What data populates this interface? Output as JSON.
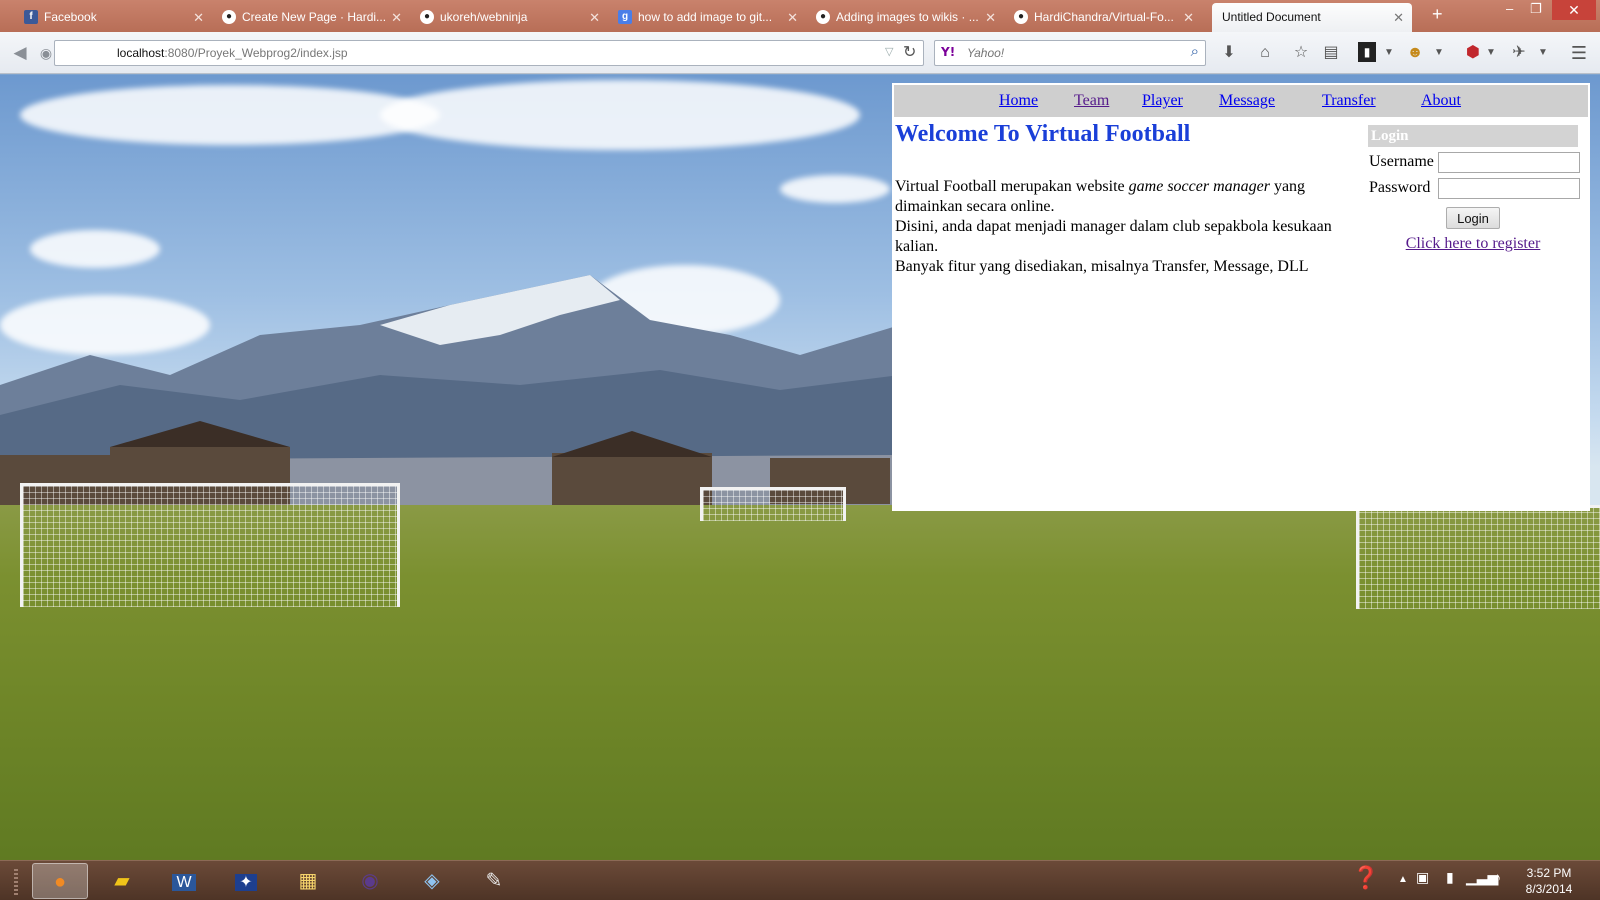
{
  "browser": {
    "tabs": [
      {
        "title": "Facebook",
        "icon": "facebook-icon"
      },
      {
        "title": "Create New Page · Hardi...",
        "icon": "github-icon"
      },
      {
        "title": "ukoreh/webninja",
        "icon": "github-icon"
      },
      {
        "title": "how to add image to git...",
        "icon": "google-icon"
      },
      {
        "title": "Adding images to wikis · ...",
        "icon": "github-icon"
      },
      {
        "title": "HardiChandra/Virtual-Fo...",
        "icon": "github-icon"
      },
      {
        "title": "Untitled Document",
        "icon": ""
      }
    ],
    "url_host": "localhost",
    "url_path": ":8080/Proyek_Webprog2/index.jsp",
    "search_placeholder": "Yahoo!",
    "search_engine_glyph": "Y!"
  },
  "page": {
    "nav": [
      "Home",
      "Team",
      "Player",
      "Message",
      "Transfer",
      "About"
    ],
    "welcome_title": "Welcome To Virtual Football",
    "intro": {
      "line1_pre": "Virtual Football merupakan website ",
      "line1_em": "game soccer manager",
      "line1_post": " yang dimainkan secara online.",
      "line2": "Disini, anda dapat menjadi manager dalam club sepakbola kesukaan kalian.",
      "line3": "Banyak fitur yang disediakan, misalnya Transfer, Message, DLL"
    },
    "login": {
      "heading": "Login",
      "username_label": "Username",
      "password_label": "Password",
      "username_value": "",
      "password_value": "",
      "button_label": "Login",
      "register_link": "Click here to register"
    }
  },
  "taskbar": {
    "time": "3:52 PM",
    "date": "8/3/2014"
  },
  "colors": {
    "tabbar": "#b86e57",
    "welcome_title": "#1a3fd8",
    "menu_bg": "#cfcfcf",
    "link": "#0000ee",
    "visited_link": "#551a8b"
  }
}
